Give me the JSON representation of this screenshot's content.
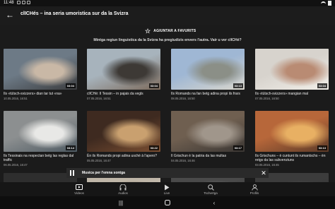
{
  "status": {
    "time": "11:48"
  },
  "appbar": {
    "title": "clICHés – ina seria umoristica sur da la Svizra"
  },
  "favorites": {
    "label": "AGIUNTAR A FAVURITS"
  },
  "subtitle": "Mintga regiun linguistica da la Svizra ha pregiudizis envers l'autra. Vair u ver clICHé?",
  "videos": [
    {
      "title": "Ils «tütsch-svizzers» dian tar tut «na»",
      "date": "10.05.2016, 16:51",
      "duration": "03:04",
      "colors": [
        "#6d7a86",
        "#c9b8a6",
        "#3b3c3e"
      ]
    },
    {
      "title": "clICHé: Il Tessin – in pajais da vegls",
      "date": "07.05.2016, 16:51",
      "duration": "03:04",
      "colors": [
        "#a7b3bc",
        "#3d3935",
        "#7c6a5b"
      ]
    },
    {
      "title": "Ils Romands na fan betg adina propi ils frars",
      "date": "08.05.2016, 16:50",
      "duration": "03:13",
      "colors": [
        "#9fb7d4",
        "#8b8f87",
        "#d9d6cc"
      ]
    },
    {
      "title": "Ils «tütsch-svizzers» mangian mal",
      "date": "07.05.2016, 16:50",
      "duration": "03:04",
      "colors": [
        "#d7d3cd",
        "#b98b73",
        "#f1eee8"
      ]
    },
    {
      "title": "Ils Tessinais na respectan betg las reglas dal traffic",
      "date": "06.05.2016, 16:47",
      "duration": "03:14",
      "colors": [
        "#8c8f90",
        "#e8e8e6",
        "#4e5a62"
      ]
    },
    {
      "title": "Èn ils Romands propi adina uschè à l'apero?",
      "date": "05.05.2016, 16:47",
      "duration": "03:22",
      "colors": [
        "#3e2a20",
        "#c9a06f",
        "#7a4e31"
      ]
    },
    {
      "title": "Il Grischun è la patria da las multas",
      "date": "04.05.2016, 16:46",
      "duration": "03:17",
      "colors": [
        "#6f5f50",
        "#a0968b",
        "#3a3633"
      ]
    },
    {
      "title": "Ils Grischuns – è cuntunt ils rumantschs – èn retgs da las subvenziuns",
      "date": "03.05.2016, 16:45",
      "duration": "03:13",
      "colors": [
        "#b7673a",
        "#e8b063",
        "#5b3a28"
      ]
    },
    {
      "title": "",
      "date": "",
      "duration": "",
      "colors": [
        "#2e2e2e",
        "#3a3a3a",
        "#262626"
      ]
    },
    {
      "title": "",
      "date": "",
      "duration": "",
      "colors": [
        "#bfb6a8",
        "#8a7c6a",
        "#d8d0c4"
      ]
    },
    {
      "title": "",
      "date": "",
      "duration": "",
      "colors": [
        "#4a4a4a",
        "#777",
        "#2f2f2f"
      ]
    },
    {
      "title": "",
      "date": "",
      "duration": "",
      "colors": [
        "#3c3c3c",
        "#555",
        "#2b2b2b"
      ]
    }
  ],
  "player": {
    "title": "Musica per l'emna sontga"
  },
  "nav": [
    {
      "label": "Videos",
      "icon": "video-icon",
      "active": true
    },
    {
      "label": "Audios",
      "icon": "audio-icon",
      "active": false
    },
    {
      "label": "Live",
      "icon": "live-icon",
      "active": false
    },
    {
      "label": "Tschertga",
      "icon": "search-icon",
      "active": false
    },
    {
      "label": "Profils",
      "icon": "profile-icon",
      "active": false
    }
  ],
  "colors": {
    "background": "#1b1b1b",
    "card_text": "#eeeeee",
    "date_text": "#aaaaaa"
  }
}
